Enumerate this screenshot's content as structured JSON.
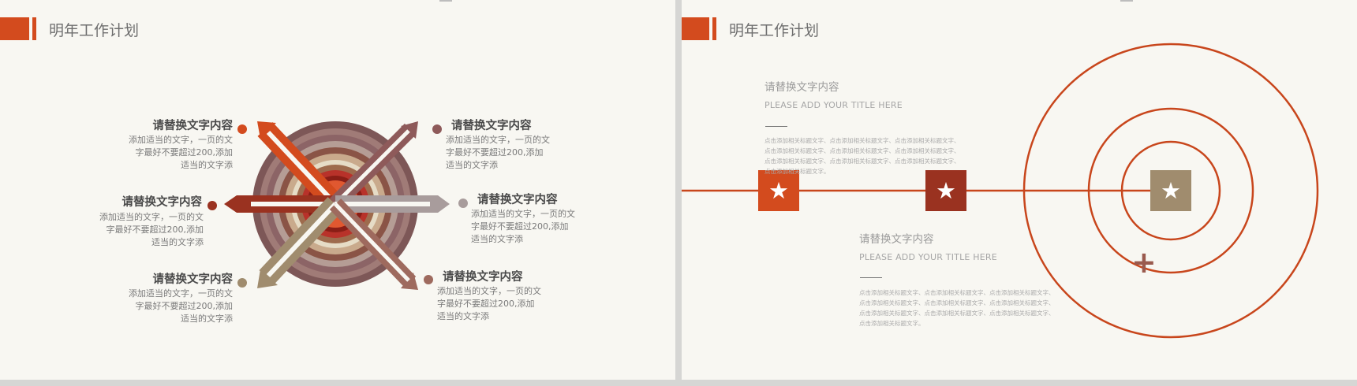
{
  "left_slide": {
    "title": "明年工作计划",
    "items": [
      {
        "heading": "请替换文字内容",
        "body": "添加适当的文字，一页的文字最好不要超过200,添加适当的文字添",
        "color": "#d34b1e"
      },
      {
        "heading": "请替换文字内容",
        "body": "添加适当的文字，一页的文字最好不要超过200,添加适当的文字添",
        "color": "#9a3220"
      },
      {
        "heading": "请替换文字内容",
        "body": "添加适当的文字，一页的文字最好不要超过200,添加适当的文字添",
        "color": "#a08c6e"
      },
      {
        "heading": "请替换文字内容",
        "body": "添加适当的文字，一页的文字最好不要超过200,添加适当的文字添",
        "color": "#8e5a5a"
      },
      {
        "heading": "请替换文字内容",
        "body": "添加适当的文字，一页的文字最好不要超过200,添加适当的文字添",
        "color": "#a89c9c"
      },
      {
        "heading": "请替换文字内容",
        "body": "添加适当的文字，一页的文字最好不要超过200,添加适当的文字添",
        "color": "#9e6a5e"
      }
    ]
  },
  "right_slide": {
    "title": "明年工作计划",
    "blocks": [
      {
        "title": "请替换文字内容",
        "subtitle": "PLEASE ADD YOUR TITLE HERE",
        "body": "点击添加相关标题文字、点击添加相关标题文字、点击添加相关标题文字、点击添加相关标题文字、点击添加相关标题文字、点击添加相关标题文字、点击添加相关标题文字、点击添加相关标题文字、点击添加相关标题文字、点击添加相关标题文字。"
      },
      {
        "title": "请替换文字内容",
        "subtitle": "PLEASE ADD YOUR TITLE HERE",
        "body": "点击添加相关标题文字、点击添加相关标题文字、点击添加相关标题文字、点击添加相关标题文字、点击添加相关标题文字、点击添加相关标题文字、点击添加相关标题文字、点击添加相关标题文字、点击添加相关标题文字、点击添加相关标题文字。"
      }
    ],
    "star_glyph": "★",
    "plus_glyph": "+"
  },
  "colors": {
    "accent": "#d34b1e",
    "dark_red": "#9a3220",
    "tan": "#a08c6e",
    "mauve": "#8e5a5a",
    "bg": "#f8f7f2"
  }
}
